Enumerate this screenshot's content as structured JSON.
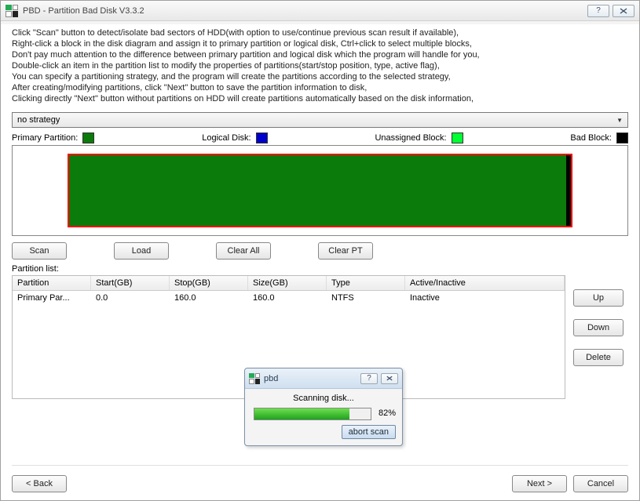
{
  "window": {
    "title": "PBD - Partition Bad Disk V3.3.2"
  },
  "intro": [
    "Click \"Scan\" button to detect/isolate bad sectors of HDD(with option to use/continue previous scan result if available),",
    "Right-click a block in the disk diagram and assign it to primary partition or logical disk, Ctrl+click to select multiple blocks,",
    "Don't pay much attention to the difference between primary partition and logical disk which the program will handle for you,",
    "Double-click an item in the partition list to modify the properties of partitions(start/stop position, type, active flag),",
    "You can specify a partitioning strategy, and the program will create the partitions according to the selected strategy,",
    "After creating/modifying partitions, click \"Next\" button to save the partition information to disk,",
    "Clicking directly \"Next\" button without partitions on HDD will create partitions automatically based on the disk information,"
  ],
  "strategy": {
    "selected": "no strategy"
  },
  "legend": {
    "primary": {
      "label": "Primary Partition:",
      "color": "#0b7b0b"
    },
    "logical": {
      "label": "Logical Disk:",
      "color": "#0000cc"
    },
    "unassigned": {
      "label": "Unassigned Block:",
      "color": "#00ff33"
    },
    "bad": {
      "label": "Bad Block:",
      "color": "#000000"
    }
  },
  "buttons": {
    "scan": "Scan",
    "load": "Load",
    "clear_all": "Clear All",
    "clear_pt": "Clear PT",
    "up": "Up",
    "down": "Down",
    "delete": "Delete",
    "back": "< Back",
    "next": "Next >",
    "cancel": "Cancel"
  },
  "partition_list": {
    "label": "Partition list:",
    "headers": {
      "partition": "Partition",
      "start": "Start(GB)",
      "stop": "Stop(GB)",
      "size": "Size(GB)",
      "type": "Type",
      "active": "Active/Inactive"
    },
    "rows": [
      {
        "partition": "Primary Par...",
        "start": "0.0",
        "stop": "160.0",
        "size": "160.0",
        "type": "NTFS",
        "active": "Inactive"
      }
    ]
  },
  "modal": {
    "title": "pbd",
    "status": "Scanning disk...",
    "percent_text": "82%",
    "percent": 82,
    "abort": "abort scan"
  }
}
